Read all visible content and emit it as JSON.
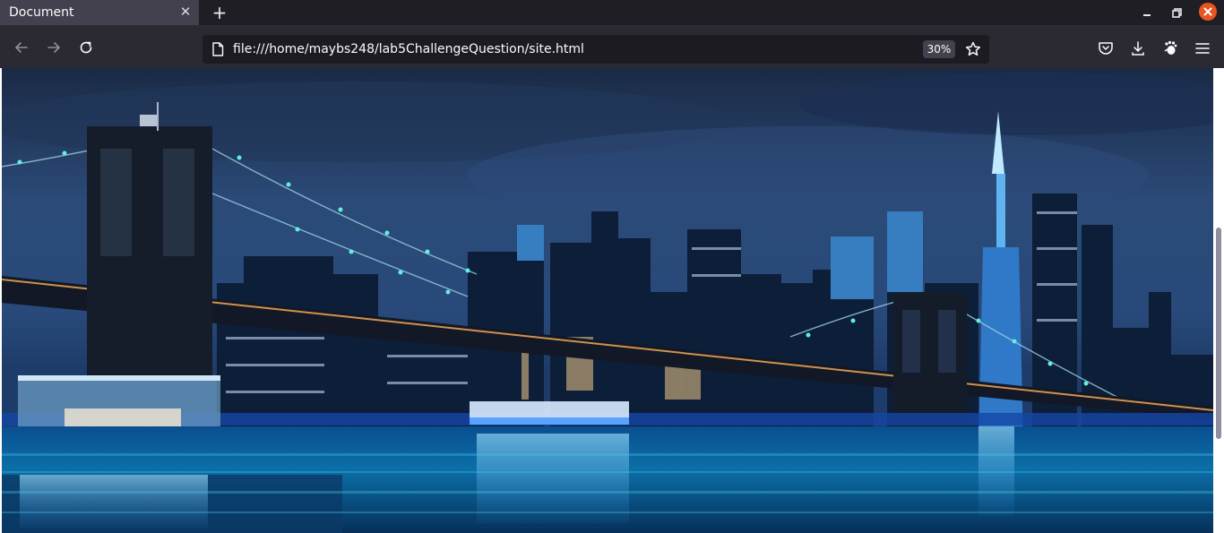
{
  "tab": {
    "title": "Document",
    "close_glyph": "✕"
  },
  "new_tab_glyph": "+",
  "window_controls": {
    "minimize_glyph": "▁",
    "maximize_glyph": "❐",
    "close_glyph": "✕"
  },
  "toolbar": {
    "back_icon": "arrow-left-icon",
    "forward_icon": "arrow-right-icon",
    "reload_icon": "reload-icon"
  },
  "urlbar": {
    "url": "file:///home/maybs248/lab5ChallengeQuestion/site.html",
    "zoom": "30%",
    "page_icon": "page-icon",
    "bookmark_icon": "star-icon"
  },
  "toolbar_right": {
    "pocket_icon": "pocket-icon",
    "downloads_icon": "download-icon",
    "extension_icon": "extension-icon",
    "menu_icon": "hamburger-menu-icon"
  },
  "colors": {
    "tab_bg": "#42414d",
    "toolbar_bg": "#2b2a33",
    "urlbar_bg": "#1c1b22",
    "close_button": "#e95420",
    "text": "#fbfbfe"
  },
  "content": {
    "image": "night-city-skyline-bridge"
  }
}
